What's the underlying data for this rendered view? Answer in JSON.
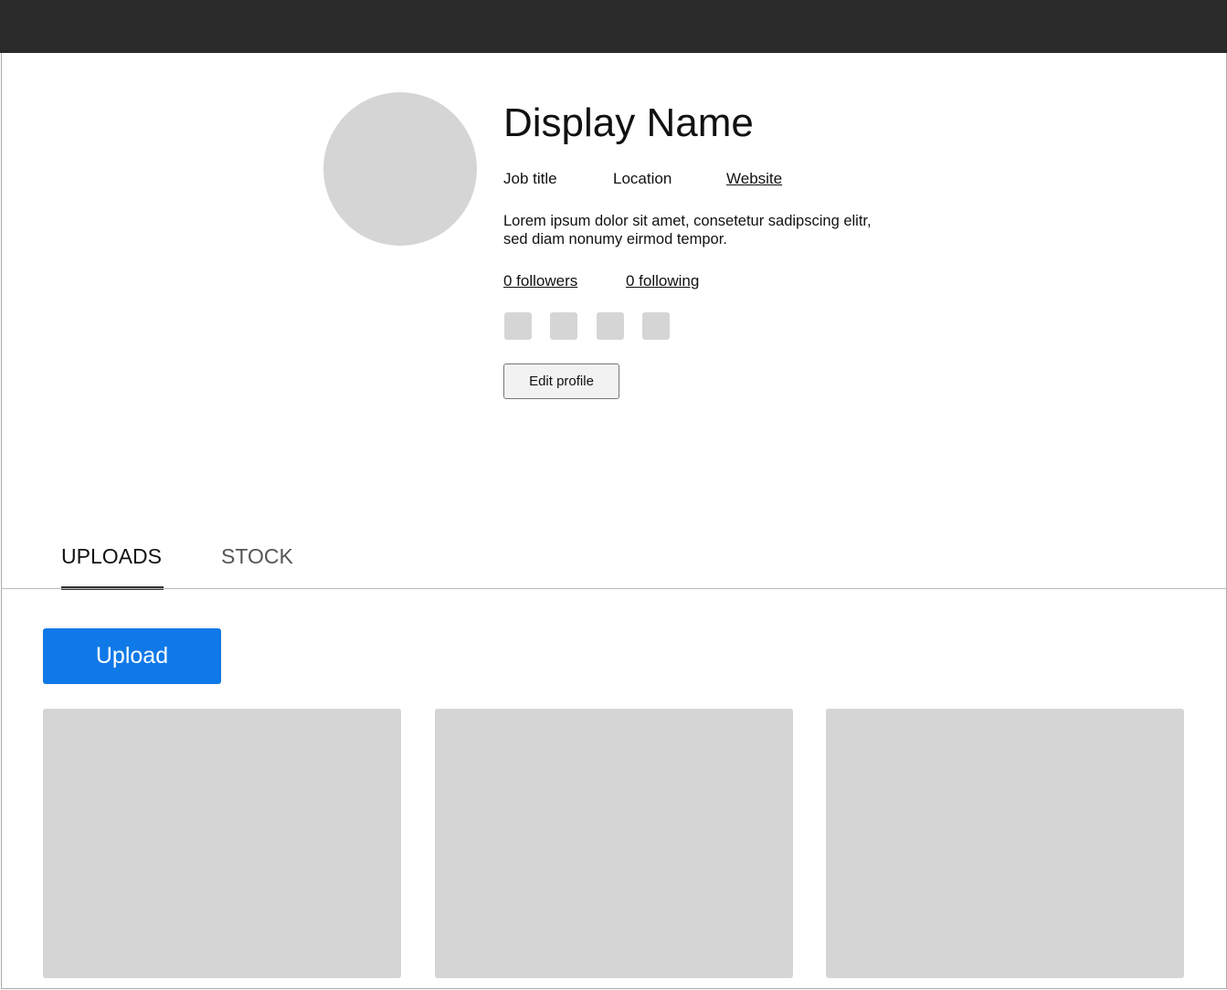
{
  "profile": {
    "display_name": "Display Name",
    "job_title": "Job title",
    "location": "Location",
    "website": "Website",
    "bio": "Lorem ipsum dolor sit amet, consetetur sadipscing elitr, sed diam nonumy eirmod tempor.",
    "followers": "0 followers",
    "following": "0 following",
    "edit_label": "Edit profile",
    "social_icons": [
      "social-icon-1",
      "social-icon-2",
      "social-icon-3",
      "social-icon-4"
    ]
  },
  "tabs": [
    {
      "label": "UPLOADS",
      "active": true
    },
    {
      "label": "STOCK",
      "active": false
    }
  ],
  "uploads": {
    "button_label": "Upload",
    "accent": "#0f79e8",
    "tiles": 3
  }
}
